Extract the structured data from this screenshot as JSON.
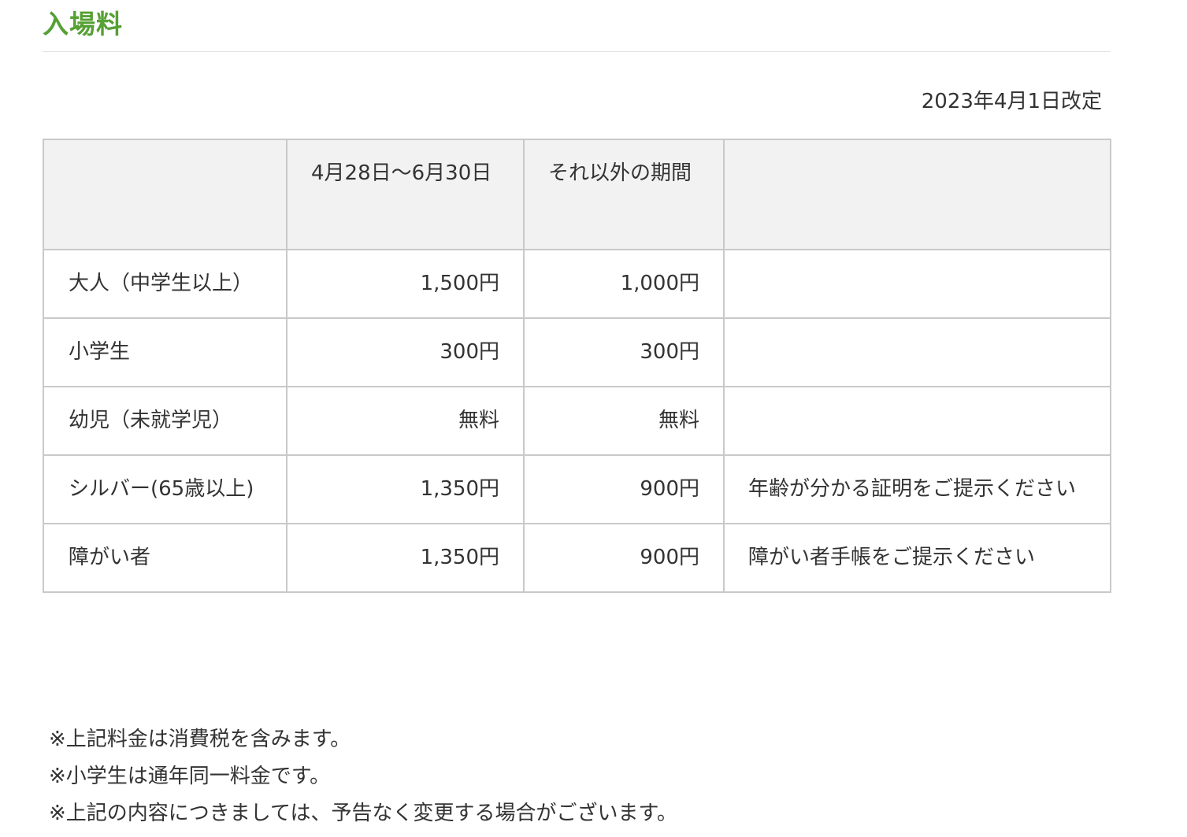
{
  "section": {
    "title": "入場料"
  },
  "revision_date": "2023年4月1日改定",
  "fee_table": {
    "headers": [
      "",
      "4月28日～6月30日",
      "それ以外の期間",
      ""
    ],
    "rows": [
      {
        "category": "大人（中学生以上）",
        "peak_price": "1,500円",
        "regular_price": "1,000円",
        "note": ""
      },
      {
        "category": "小学生",
        "peak_price": "300円",
        "regular_price": "300円",
        "note": ""
      },
      {
        "category": "幼児（未就学児）",
        "peak_price": "無料",
        "regular_price": "無料",
        "note": ""
      },
      {
        "category": "シルバー(65歳以上)",
        "peak_price": "1,350円",
        "regular_price": "900円",
        "note": "年齢が分かる証明をご提示ください"
      },
      {
        "category": "障がい者",
        "peak_price": "1,350円",
        "regular_price": "900円",
        "note": "障がい者手帳をご提示ください"
      }
    ]
  },
  "notes": [
    "※上記料金は消費税を含みます。",
    "※小学生は通年同一料金です。",
    "※上記の内容につきましては、予告なく変更する場合がございます。"
  ],
  "colors": {
    "title_green": "#56a034",
    "header_background": "#f1f2f1",
    "border": "#c9c9c9",
    "text": "#333333"
  }
}
